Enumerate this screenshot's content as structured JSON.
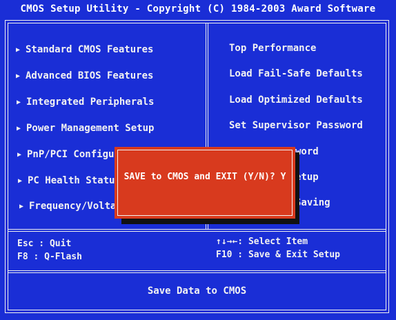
{
  "title": "CMOS Setup Utility - Copyright (C) 1984-2003 Award Software",
  "left_menu": [
    {
      "label": "Standard CMOS Features"
    },
    {
      "label": "Advanced BIOS Features"
    },
    {
      "label": "Integrated Peripherals"
    },
    {
      "label": "Power Management Setup"
    },
    {
      "label": "PnP/PCI Configura"
    },
    {
      "label": "PC Health Status"
    },
    {
      "label": "Frequency/Voltage"
    }
  ],
  "arrow_glyph": "▶",
  "right_menu": [
    {
      "label": "Top Performance"
    },
    {
      "label": "Load Fail-Safe Defaults"
    },
    {
      "label": "Load Optimized Defaults"
    },
    {
      "label": "Set Supervisor Password"
    },
    {
      "label": "word"
    },
    {
      "label": "etup"
    },
    {
      "label": "Saving"
    }
  ],
  "hints": {
    "esc": "Esc : Quit",
    "f8": "F8  : Q-Flash",
    "nav": "↑↓→←: Select Item",
    "f10": "F10 : Save & Exit Setup"
  },
  "status_text": "Save Data to CMOS",
  "dialog": {
    "text": "SAVE to CMOS and EXIT (Y/N)? Y"
  },
  "colors": {
    "background": "#1a2ed6",
    "dialog": "#d83a1e",
    "text": "#f2f2f2"
  }
}
